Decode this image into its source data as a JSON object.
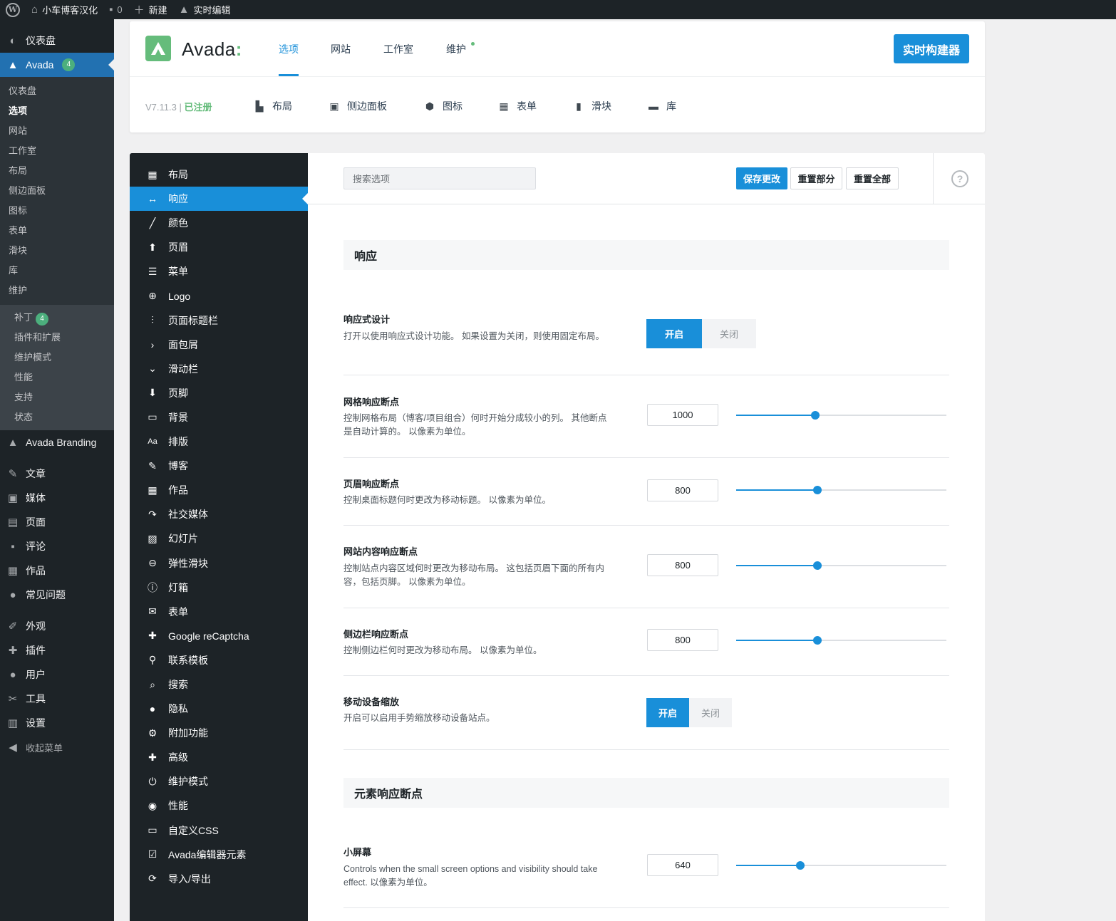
{
  "adminbar": {
    "site_name": "小车博客汉化",
    "comments_count": "0",
    "new_label": "新建",
    "live_edit_label": "实时编辑"
  },
  "wp_menu": {
    "dashboard": "仪表盘",
    "avada": "Avada",
    "avada_badge": "4",
    "avada_sub": [
      "仪表盘",
      "选项",
      "网站",
      "工作室",
      "布局",
      "侧边面板",
      "图标",
      "表单",
      "滑块",
      "库",
      "维护"
    ],
    "maint_sub": [
      {
        "label": "补丁",
        "badge": "4"
      },
      {
        "label": "插件和扩展"
      },
      {
        "label": "维护模式"
      },
      {
        "label": "性能"
      },
      {
        "label": "支持"
      },
      {
        "label": "状态"
      }
    ],
    "branding": "Avada Branding",
    "group1": [
      "文章",
      "媒体",
      "页面",
      "评论",
      "作品",
      "常见问题"
    ],
    "group2": [
      "外观",
      "插件",
      "用户",
      "工具",
      "设置"
    ],
    "collapse": "收起菜单"
  },
  "avada_header": {
    "logo_text": "Avada",
    "logo_colon": ":",
    "tabs": [
      "选项",
      "网站",
      "工作室",
      "维护"
    ],
    "live_builder": "实时构建器",
    "version": "V7.11.3",
    "version_sep": "|",
    "registered": "已注册",
    "sub_tabs": [
      "布局",
      "侧边面板",
      "图标",
      "表单",
      "滑块",
      "库"
    ]
  },
  "options_nav": [
    {
      "label": "布局",
      "icon": "layout-icon"
    },
    {
      "label": "响应",
      "icon": "arrows-horizontal-icon"
    },
    {
      "label": "颜色",
      "icon": "brush-icon"
    },
    {
      "label": "页眉",
      "icon": "arrow-up-icon"
    },
    {
      "label": "菜单",
      "icon": "menu-icon"
    },
    {
      "label": "Logo",
      "icon": "plus-circle-icon"
    },
    {
      "label": "页面标题栏",
      "icon": "sliders-icon"
    },
    {
      "label": "面包屑",
      "icon": "chevron-right-icon"
    },
    {
      "label": "滑动栏",
      "icon": "chevron-down-icon"
    },
    {
      "label": "页脚",
      "icon": "arrow-down-icon"
    },
    {
      "label": "背景",
      "icon": "background-icon"
    },
    {
      "label": "排版",
      "icon": "typography-icon"
    },
    {
      "label": "博客",
      "icon": "edit-icon"
    },
    {
      "label": "作品",
      "icon": "grid-icon"
    },
    {
      "label": "社交媒体",
      "icon": "share-icon"
    },
    {
      "label": "幻灯片",
      "icon": "image-icon"
    },
    {
      "label": "弹性滑块",
      "icon": "slider-icon"
    },
    {
      "label": "灯箱",
      "icon": "info-icon"
    },
    {
      "label": "表单",
      "icon": "envelope-icon"
    },
    {
      "label": "Google reCaptcha",
      "icon": "puzzle-icon"
    },
    {
      "label": "联系模板",
      "icon": "map-pin-icon"
    },
    {
      "label": "搜索",
      "icon": "search-icon"
    },
    {
      "label": "隐私",
      "icon": "user-icon"
    },
    {
      "label": "附加功能",
      "icon": "cogs-icon"
    },
    {
      "label": "高级",
      "icon": "puzzle-icon"
    },
    {
      "label": "维护模式",
      "icon": "power-icon"
    },
    {
      "label": "性能",
      "icon": "gauge-icon"
    },
    {
      "label": "自定义CSS",
      "icon": "css-icon"
    },
    {
      "label": "Avada编辑器元素",
      "icon": "checkbox-icon"
    },
    {
      "label": "导入/导出",
      "icon": "refresh-icon"
    }
  ],
  "toolbar": {
    "search_placeholder": "搜索选项",
    "save": "保存更改",
    "reset_section": "重置部分",
    "reset_all": "重置全部",
    "help": "?"
  },
  "section_responsive": "响应",
  "fields": {
    "responsive_design": {
      "title": "响应式设计",
      "desc": "打开以使用响应式设计功能。 如果设置为关闭，则使用固定布局。",
      "on": "开启",
      "off": "关闭"
    },
    "grid_breakpoint": {
      "title": "网格响应断点",
      "desc": "控制网格布局（博客/项目组合）何时开始分成较小的列。 其他断点是自动计算的。 以像素为单位。",
      "value": "1000",
      "fraction": 0.376
    },
    "header_breakpoint": {
      "title": "页眉响应断点",
      "desc": "控制桌面标题何时更改为移动标题。 以像素为单位。",
      "value": "800",
      "fraction": 0.386
    },
    "content_breakpoint": {
      "title": "网站内容响应断点",
      "desc": "控制站点内容区域何时更改为移动布局。 这包括页眉下面的所有内容，包括页脚。 以像素为单位。",
      "value": "800",
      "fraction": 0.386
    },
    "sidebar_breakpoint": {
      "title": "侧边栏响应断点",
      "desc": "控制侧边栏何时更改为移动布局。 以像素为单位。",
      "value": "800",
      "fraction": 0.386
    },
    "mobile_zoom": {
      "title": "移动设备缩放",
      "desc": "开启可以启用手势缩放移动设备站点。",
      "on": "开启",
      "off": "关闭"
    }
  },
  "section_elements": "元素响应断点",
  "small_screen": {
    "title": "小屏幕",
    "desc": "Controls when the small screen options and visibility should take effect. 以像素为单位。",
    "value": "640",
    "fraction": 0.305
  },
  "colors": {
    "accent": "#198fd9",
    "wp_blue": "#2271b1",
    "avada_green": "#65bc7b",
    "dark": "#1d2327"
  }
}
